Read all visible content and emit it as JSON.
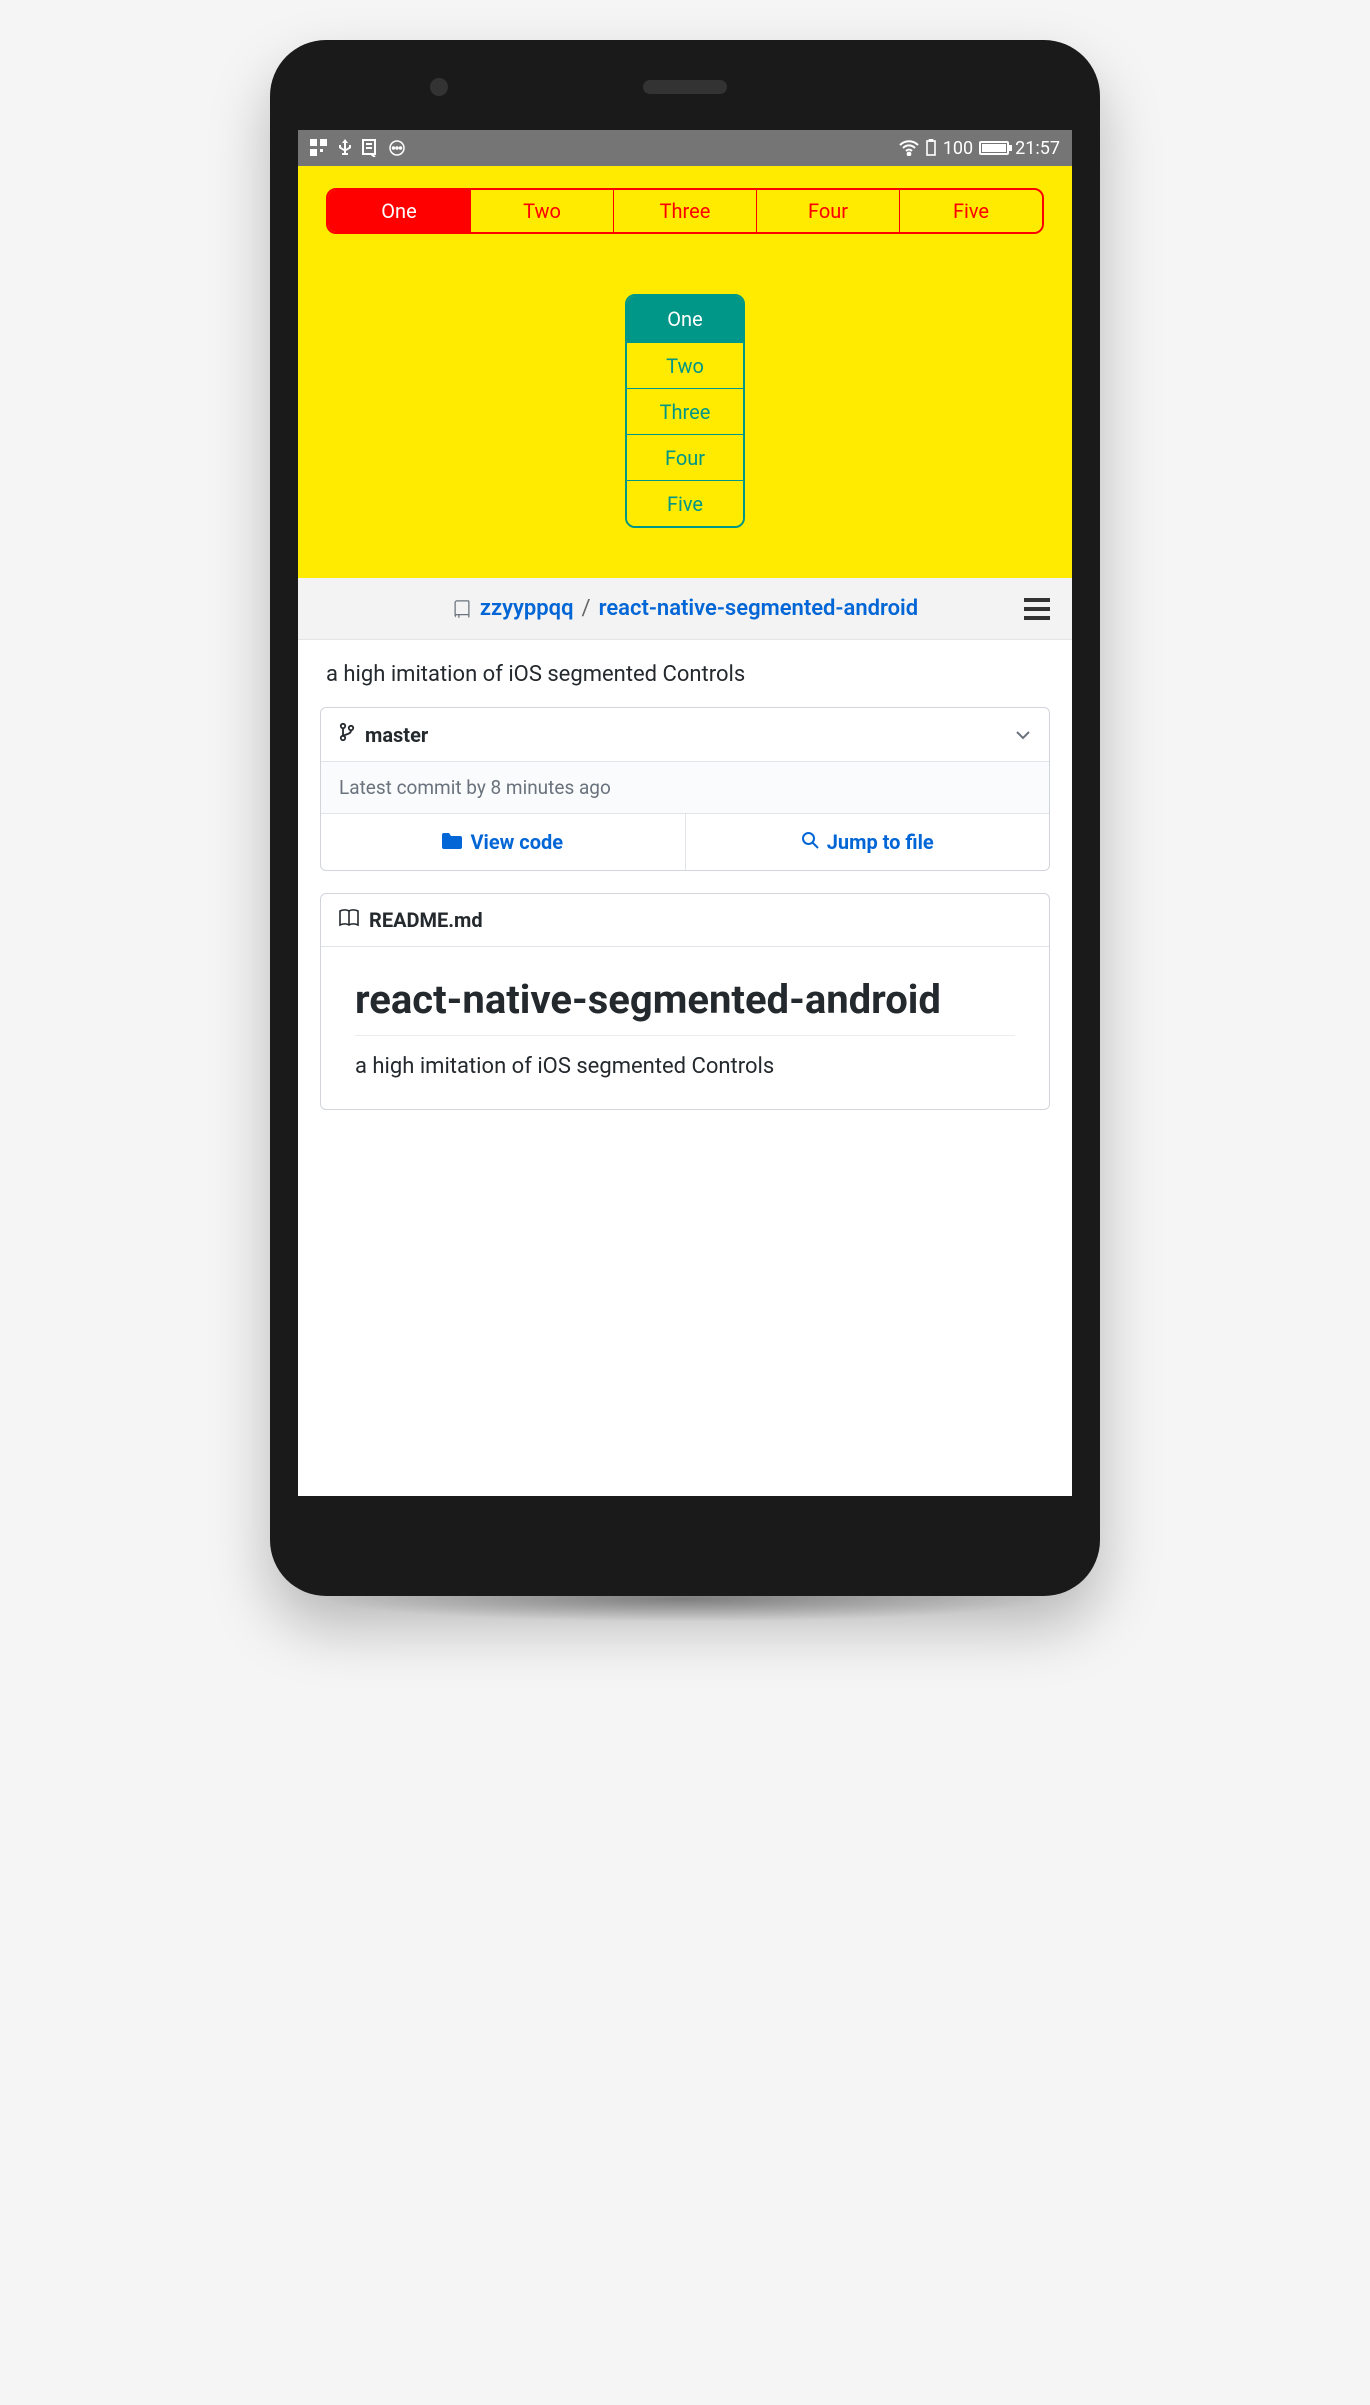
{
  "status": {
    "battery": "100",
    "time": "21:57"
  },
  "segH": {
    "items": [
      "One",
      "Two",
      "Three",
      "Four",
      "Five"
    ],
    "selectedIndex": 0
  },
  "segV": {
    "items": [
      "One",
      "Two",
      "Three",
      "Four",
      "Five"
    ],
    "selectedIndex": 0
  },
  "repo": {
    "owner": "zzyyppqq",
    "name": "react-native-segmented-android",
    "sep": "/",
    "description": "a high imitation of iOS segmented Controls",
    "branch": "master",
    "latestCommit": "Latest commit by 8 minutes ago",
    "viewCode": "View code",
    "jumpToFile": "Jump to file",
    "readmeFile": "README.md",
    "readmeTitle": "react-native-segmented-android",
    "readmeDesc": "a high imitation of iOS segmented Controls"
  }
}
